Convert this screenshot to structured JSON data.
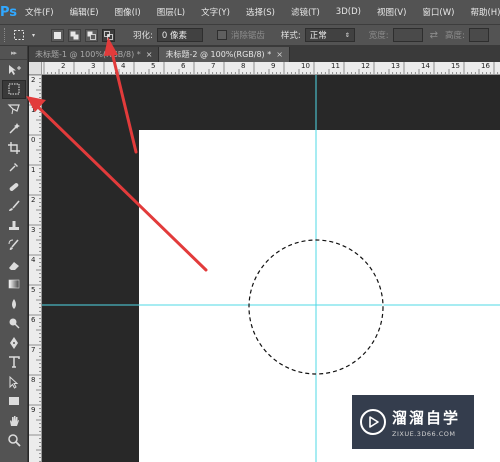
{
  "app": {
    "logo": "Ps",
    "menu": [
      "文件(F)",
      "编辑(E)",
      "图像(I)",
      "图层(L)",
      "文字(Y)",
      "选择(S)",
      "滤镜(T)",
      "3D(D)",
      "视图(V)",
      "窗口(W)",
      "帮助(H)"
    ],
    "window_controls": [
      "—",
      "□",
      "✕"
    ]
  },
  "options_bar": {
    "feather_label": "羽化:",
    "feather_value": "0 像素",
    "antialias_label": "消除锯齿",
    "style_label": "样式:",
    "style_value": "正常",
    "width_label": "宽度:",
    "height_label": "高度:",
    "swap_icon": "swap-icon"
  },
  "toolbox": {
    "head": "▸▸",
    "tools": [
      "move",
      "elliptical-marquee",
      "lasso",
      "quick-select",
      "crop",
      "eyedropper",
      "spot-healing",
      "brush",
      "clone-stamp",
      "history-brush",
      "eraser",
      "gradient",
      "blur",
      "dodge",
      "pen",
      "type",
      "path-select",
      "rectangle",
      "hand",
      "zoom"
    ]
  },
  "tabs": [
    {
      "label": "未标题-1 @ 100%(RGB/8) *",
      "close": "×",
      "active": false
    },
    {
      "label": "未标题-2 @ 100%(RGB/8) *",
      "close": "×",
      "active": true
    }
  ],
  "ruler_top": [
    "2",
    "3",
    "4",
    "5",
    "6",
    "7",
    "8",
    "9",
    "10",
    "11",
    "12",
    "13",
    "14",
    "15",
    "16"
  ],
  "ruler_left": [
    "2",
    "1",
    "0",
    "1",
    "2",
    "3",
    "4",
    "5",
    "6",
    "7",
    "8",
    "9"
  ],
  "watermark": {
    "name": "溜溜自学",
    "url": "ZIXUE.3D66.COM"
  },
  "colors": {
    "guide": "#4fd8e6",
    "arrow": "#e23b3b",
    "chrome": "#535353",
    "pasteboard": "#282828"
  }
}
